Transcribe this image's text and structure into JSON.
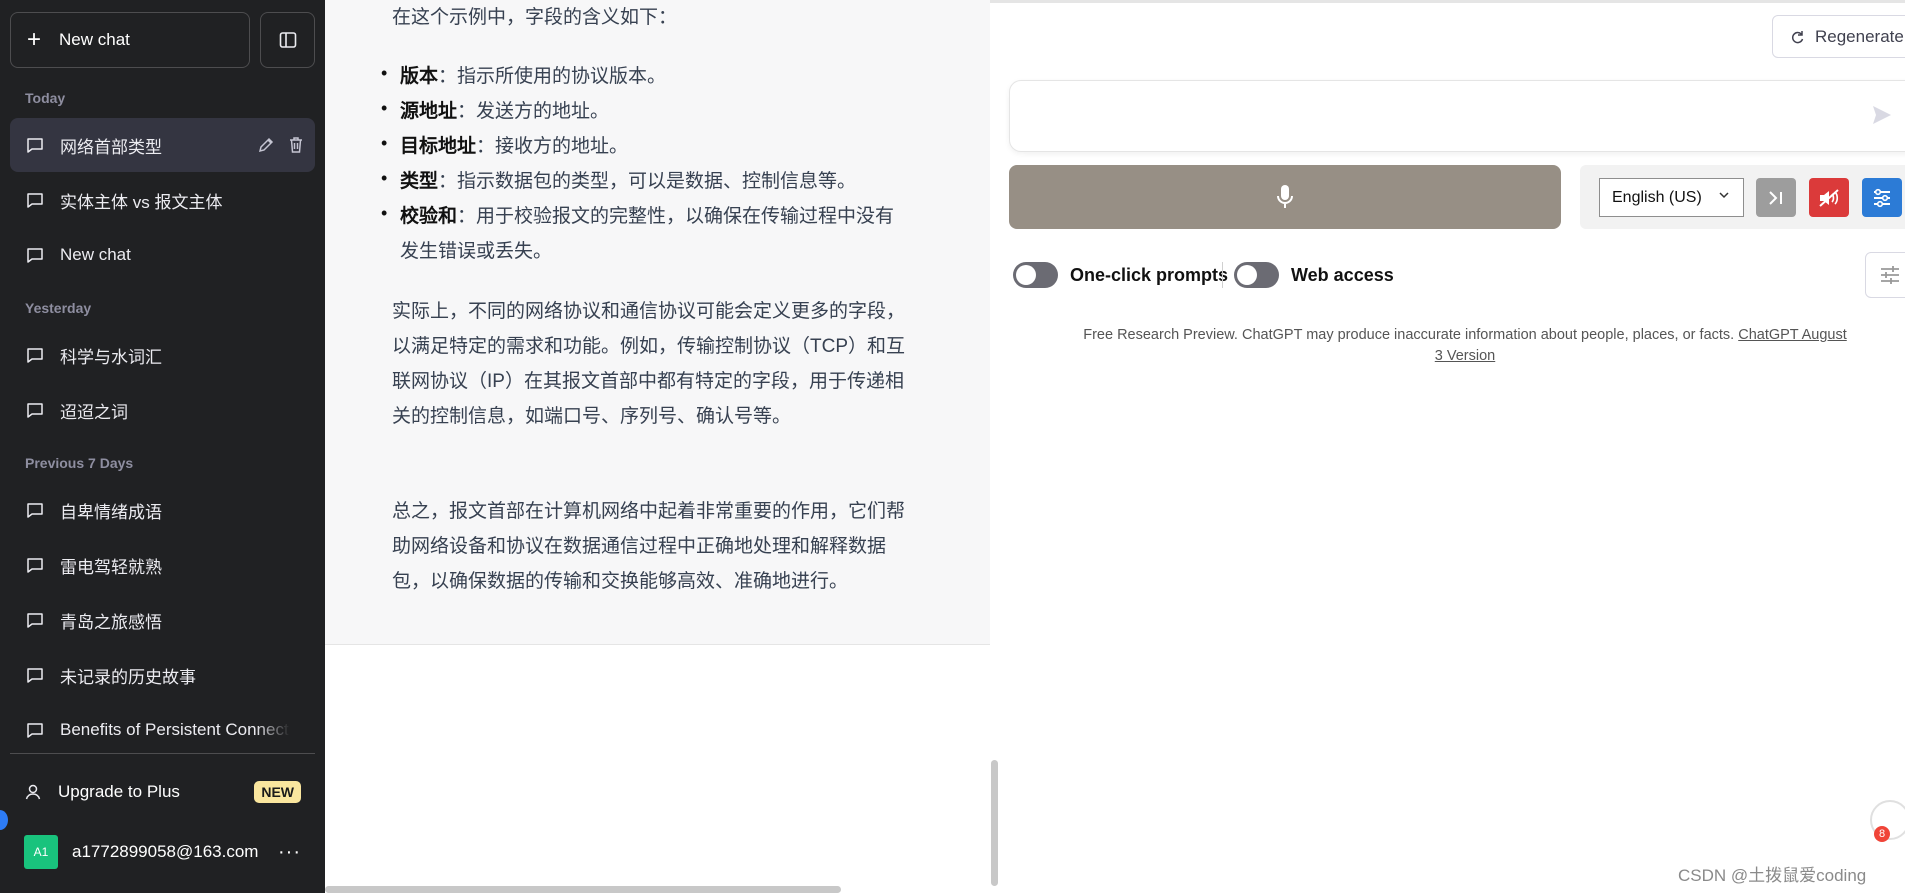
{
  "sidebar": {
    "new_chat_label": "New chat",
    "sections": {
      "today": "Today",
      "yesterday": "Yesterday",
      "previous7": "Previous 7 Days"
    },
    "items": [
      {
        "label": "网络首部类型"
      },
      {
        "label": "实体主体 vs 报文主体"
      },
      {
        "label": "New chat"
      },
      {
        "label": "科学与水词汇"
      },
      {
        "label": "迢迢之词"
      },
      {
        "label": "自卑情绪成语"
      },
      {
        "label": "雷电驾轻就熟"
      },
      {
        "label": "青岛之旅感悟"
      },
      {
        "label": "未记录的历史故事"
      },
      {
        "label": "Benefits of Persistent Connect"
      }
    ],
    "upgrade_label": "Upgrade to Plus",
    "upgrade_badge": "NEW",
    "account_avatar": "A1",
    "account_email": "a1772899058@163.com",
    "more_label": "···"
  },
  "message": {
    "intro": "在这个示例中，字段的含义如下：",
    "bullets": [
      {
        "term": "版本",
        "desc": "：指示所使用的协议版本。"
      },
      {
        "term": "源地址",
        "desc": "：发送方的地址。"
      },
      {
        "term": "目标地址",
        "desc": "：接收方的地址。"
      },
      {
        "term": "类型",
        "desc": "：指示数据包的类型，可以是数据、控制信息等。"
      },
      {
        "term": "校验和",
        "desc": "：用于校验报文的完整性，以确保在传输过程中没有发生错误或丢失。"
      }
    ],
    "paragraph1": "实际上，不同的网络协议和通信协议可能会定义更多的字段，以满足特定的需求和功能。例如，传输控制协议（TCP）和互联网协议（IP）在其报文首部中都有特定的字段，用于传递相关的控制信息，如端口号、序列号、确认号等。",
    "paragraph2": "总之，报文首部在计算机网络中起着非常重要的作用，它们帮助网络设备和协议在数据通信过程中正确地处理和解释数据包，以确保数据的传输和交换能够高效、准确地进行。"
  },
  "composer": {
    "regenerate_label": "Regenerate",
    "input_value": "",
    "language": "English (US)",
    "toggles": [
      {
        "label": "One-click prompts",
        "on": false
      },
      {
        "label": "Web access",
        "on": false
      }
    ],
    "disclaimer_text": "Free Research Preview. ChatGPT may produce inaccurate information about people, places, or facts. ",
    "disclaimer_link": "ChatGPT August 3 Version"
  },
  "widget": {
    "badge_count": "8"
  },
  "watermark": "CSDN @土拨鼠爱coding",
  "colors": {
    "sidebar_bg": "#202123",
    "active_item_bg": "#343541",
    "mic_button": "#978f85",
    "mute_button": "#db3a3a",
    "settings_button": "#2c7bd6",
    "new_badge": "#fae69e",
    "avatar": "#19c37d"
  }
}
